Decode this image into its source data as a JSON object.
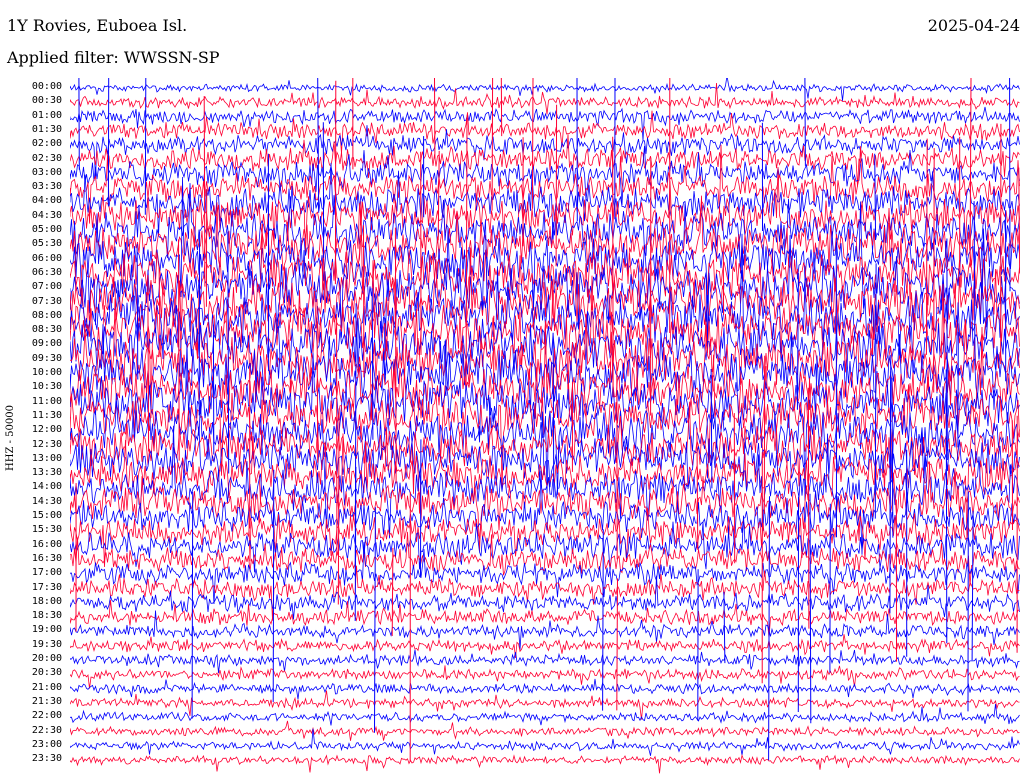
{
  "header": {
    "station": "1Y Rovies, Euboea Isl.",
    "filter": "Applied filter: WWSSN-SP",
    "date": "2025-04-24"
  },
  "chart_data": {
    "type": "line",
    "title": "1Y Rovies, Euboea Isl.",
    "subtitle": "Applied filter: WWSSN-SP",
    "date": "2025-04-24",
    "ylabel": "HHZ - 50000",
    "ytick_labels": [
      "00:00",
      "00:30",
      "01:00",
      "01:30",
      "02:00",
      "02:30",
      "03:00",
      "03:30",
      "04:00",
      "04:30",
      "05:00",
      "05:30",
      "06:00",
      "06:30",
      "07:00",
      "07:30",
      "08:00",
      "08:30",
      "09:00",
      "09:30",
      "10:00",
      "10:30",
      "11:00",
      "11:30",
      "12:00",
      "12:30",
      "13:00",
      "13:30",
      "14:00",
      "14:30",
      "15:00",
      "15:30",
      "16:00",
      "16:30",
      "17:00",
      "17:30",
      "18:00",
      "18:30",
      "19:00",
      "19:30",
      "20:00",
      "20:30",
      "21:00",
      "21:30",
      "22:00",
      "22:30",
      "23:00",
      "23:30"
    ],
    "trace_colors": [
      "#0000ff",
      "#ff0033"
    ],
    "grid": false,
    "legend": "none",
    "xlim": [
      0,
      30
    ],
    "row_amplitude": [
      0.7,
      1.1,
      1.35,
      1.6,
      1.9,
      2.1,
      2.4,
      2.7,
      3.0,
      3.3,
      3.6,
      3.9,
      4.1,
      4.3,
      4.4,
      4.5,
      4.6,
      4.6,
      4.5,
      4.4,
      4.4,
      4.3,
      4.3,
      4.2,
      4.1,
      3.9,
      3.7,
      3.5,
      3.3,
      3.1,
      2.9,
      2.7,
      2.5,
      2.3,
      2.1,
      1.9,
      1.7,
      1.5,
      1.35,
      1.2,
      1.1,
      1.0,
      0.95,
      0.9,
      0.9,
      0.85,
      0.85,
      0.8
    ],
    "event_count": 95
  }
}
